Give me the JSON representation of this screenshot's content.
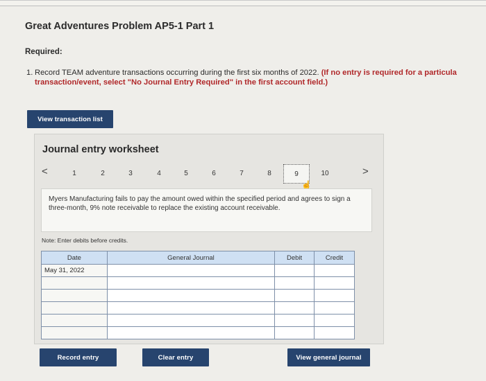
{
  "header": {
    "title": "Great Adventures Problem AP5-1 Part 1"
  },
  "required": {
    "label": "Required:",
    "item_number": "1.",
    "instruction_plain": "Record TEAM adventure transactions occurring during the first six months of 2022.",
    "instruction_red_part1": "(If no entry is required for a particula",
    "instruction_red_part2": "transaction/event, select \"No Journal Entry Required\" in the first account field.)"
  },
  "buttons": {
    "view_transaction_list": "View transaction list",
    "record_entry": "Record entry",
    "clear_entry": "Clear entry",
    "view_general_journal": "View general journal"
  },
  "worksheet": {
    "title": "Journal entry worksheet",
    "pager": {
      "prev": "<",
      "next": ">",
      "pages": [
        "1",
        "2",
        "3",
        "4",
        "5",
        "6",
        "7",
        "8",
        "9",
        "10"
      ],
      "active": "9"
    },
    "description": "Myers Manufacturing fails to pay the amount owed within the specified period and agrees to sign a three-month, 9% note receivable to replace the existing account receivable.",
    "note": "Note: Enter debits before credits.",
    "table": {
      "headers": {
        "date": "Date",
        "general_journal": "General Journal",
        "debit": "Debit",
        "credit": "Credit"
      },
      "rows": [
        {
          "date": "May 31, 2022",
          "account": "",
          "debit": "",
          "credit": ""
        },
        {
          "date": "",
          "account": "",
          "debit": "",
          "credit": ""
        },
        {
          "date": "",
          "account": "",
          "debit": "",
          "credit": ""
        },
        {
          "date": "",
          "account": "",
          "debit": "",
          "credit": ""
        },
        {
          "date": "",
          "account": "",
          "debit": "",
          "credit": ""
        },
        {
          "date": "",
          "account": "",
          "debit": "",
          "credit": ""
        }
      ]
    }
  },
  "colors": {
    "button_bg": "#27446e",
    "header_bg": "#cfe0f3",
    "instruction_red": "#b0282a"
  }
}
